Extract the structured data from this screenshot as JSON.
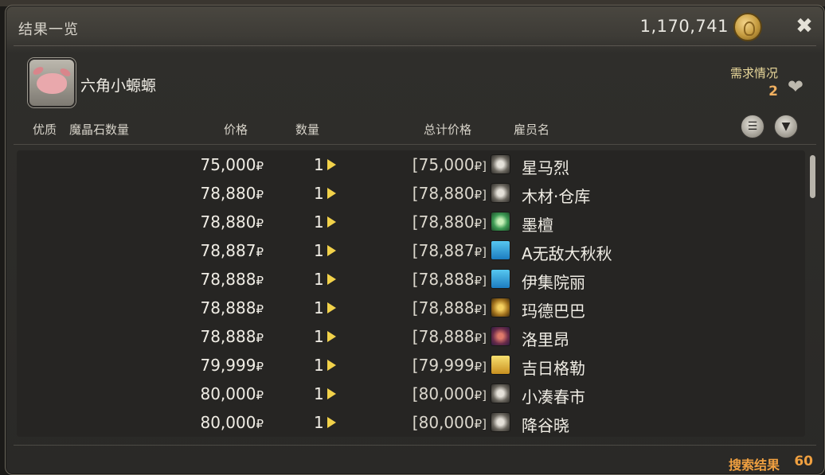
{
  "window": {
    "title": "结果一览",
    "gil": "1,170,741",
    "gil_icon": "gil-coin-icon",
    "close_icon": "close-icon"
  },
  "item": {
    "name": "六角小螈螈",
    "icon": "axolotl-item-icon",
    "demand_label": "需求情况",
    "demand_value": "2"
  },
  "columns": {
    "hq": "优质",
    "materia": "魔晶石数量",
    "price": "价格",
    "quantity": "数量",
    "total": "总计价格",
    "retainer": "雇员名"
  },
  "rows": [
    {
      "price": "75,000",
      "qty": "1",
      "total": "[75,000",
      "retainer": "星马烈",
      "city_icon": "silver-city-icon"
    },
    {
      "price": "78,880",
      "qty": "1",
      "total": "[78,880",
      "retainer": "木材·仓库",
      "city_icon": "silver-city-icon"
    },
    {
      "price": "78,880",
      "qty": "1",
      "total": "[78,880",
      "retainer": "墨檀",
      "city_icon": "green-city-icon"
    },
    {
      "price": "78,887",
      "qty": "1",
      "total": "[78,887",
      "retainer": "A无敌大秋秋",
      "city_icon": "cyan-city-icon"
    },
    {
      "price": "78,888",
      "qty": "1",
      "total": "[78,888",
      "retainer": "伊集院丽",
      "city_icon": "cyan-city-icon"
    },
    {
      "price": "78,888",
      "qty": "1",
      "total": "[78,888",
      "retainer": "玛德巴巴",
      "city_icon": "gold-city-icon"
    },
    {
      "price": "78,888",
      "qty": "1",
      "total": "[78,888",
      "retainer": "洛里昂",
      "city_icon": "red-city-icon"
    },
    {
      "price": "79,999",
      "qty": "1",
      "total": "[79,999",
      "retainer": "吉日格勒",
      "city_icon": "yellow-city-icon"
    },
    {
      "price": "80,000",
      "qty": "1",
      "total": "[80,000",
      "retainer": "小凑春市",
      "city_icon": "silver-city-icon"
    },
    {
      "price": "80,000",
      "qty": "1",
      "total": "[80,000",
      "retainer": "降谷晓",
      "city_icon": "silver-city-icon"
    }
  ],
  "currency_symbol": "₽",
  "total_suffix": "₽]",
  "footer": {
    "label": "搜索结果",
    "count": "60"
  }
}
